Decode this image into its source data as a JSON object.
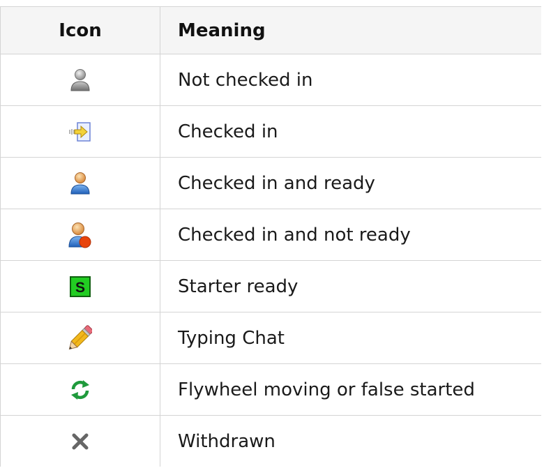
{
  "table": {
    "headers": {
      "icon": "Icon",
      "meaning": "Meaning"
    },
    "rows": [
      {
        "icon": "user-gray-icon",
        "meaning": "Not checked in"
      },
      {
        "icon": "check-in-arrow-icon",
        "meaning": "Checked in"
      },
      {
        "icon": "user-blue-icon",
        "meaning": "Checked in and ready"
      },
      {
        "icon": "user-not-ready-icon",
        "meaning": "Checked in and not ready"
      },
      {
        "icon": "starter-s-icon",
        "meaning": "Starter ready",
        "badge_letter": "S"
      },
      {
        "icon": "pencil-icon",
        "meaning": "Typing Chat"
      },
      {
        "icon": "refresh-arrows-icon",
        "meaning": "Flywheel moving or false started"
      },
      {
        "icon": "withdrawn-x-icon",
        "meaning": "Withdrawn"
      }
    ]
  },
  "colors": {
    "border": "#d4d4d4",
    "header_bg": "#f5f5f5",
    "starter_green": "#22cc22",
    "ready_blue": "#2f7fd6",
    "not_ready_red": "#e8440c",
    "refresh_green": "#1f9a3c"
  }
}
